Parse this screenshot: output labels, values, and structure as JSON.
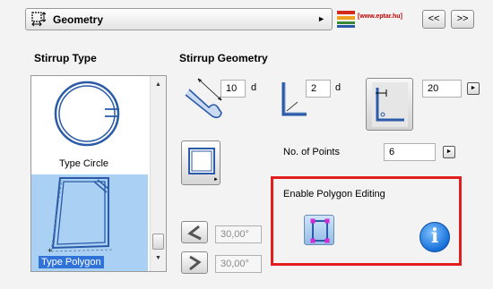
{
  "header": {
    "geometry_dropdown": "Geometry",
    "brand_text": "[www.eptar.hu]",
    "prev_button": "<<",
    "next_button": ">>",
    "logo_colors": [
      "#d42a1c",
      "#f0a020",
      "#3a8a3a",
      "#2a5aa8"
    ]
  },
  "stirrup_type": {
    "heading": "Stirrup Type",
    "items": [
      {
        "label": "Type Circle",
        "selected": false
      },
      {
        "label": "Type Polygon",
        "selected": true
      }
    ]
  },
  "stirrup_geometry": {
    "heading": "Stirrup Geometry",
    "hook_length": "10",
    "hook_unit": "d",
    "bend_length": "2",
    "bend_unit": "d",
    "corner_value": "20",
    "points_label": "No. of Points",
    "points_value": "6",
    "angle_1": "30,00°",
    "angle_2": "30,00°"
  },
  "polygon_editing": {
    "label": "Enable Polygon Editing",
    "info_symbol": "i"
  },
  "colors": {
    "highlight_border": "#e21d1d",
    "selection_blue": "#2f73d8",
    "selected_bg": "#aad0f4"
  }
}
